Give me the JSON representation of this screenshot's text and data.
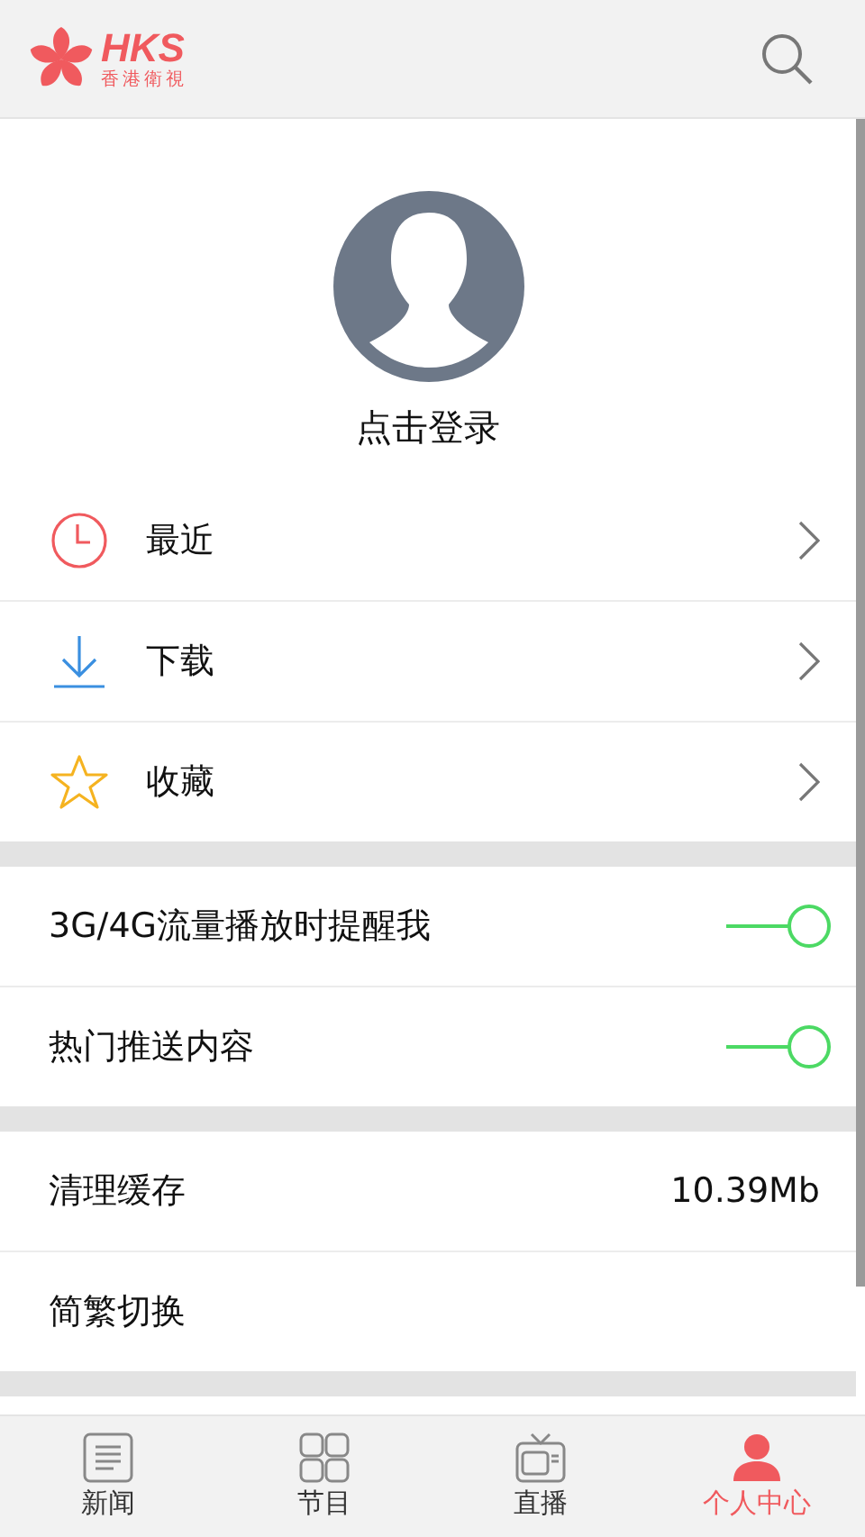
{
  "header": {
    "logo_text": "HKS",
    "logo_subtitle": "香港衛視"
  },
  "profile": {
    "login_label": "点击登录"
  },
  "menu": [
    {
      "label": "最近"
    },
    {
      "label": "下载"
    },
    {
      "label": "收藏"
    }
  ],
  "settings": [
    [
      {
        "kind": "toggle",
        "label": "3G/4G流量播放时提醒我",
        "on": true
      },
      {
        "kind": "toggle",
        "label": "热门推送内容",
        "on": true
      }
    ],
    [
      {
        "kind": "value",
        "label": "清理缓存",
        "value": "10.39Mb"
      },
      {
        "kind": "plain",
        "label": "简繁切换"
      }
    ]
  ],
  "tabs": [
    {
      "label": "新闻",
      "selected": false
    },
    {
      "label": "节目",
      "selected": false
    },
    {
      "label": "直播",
      "selected": false
    },
    {
      "label": "个人中心",
      "selected": true
    }
  ]
}
